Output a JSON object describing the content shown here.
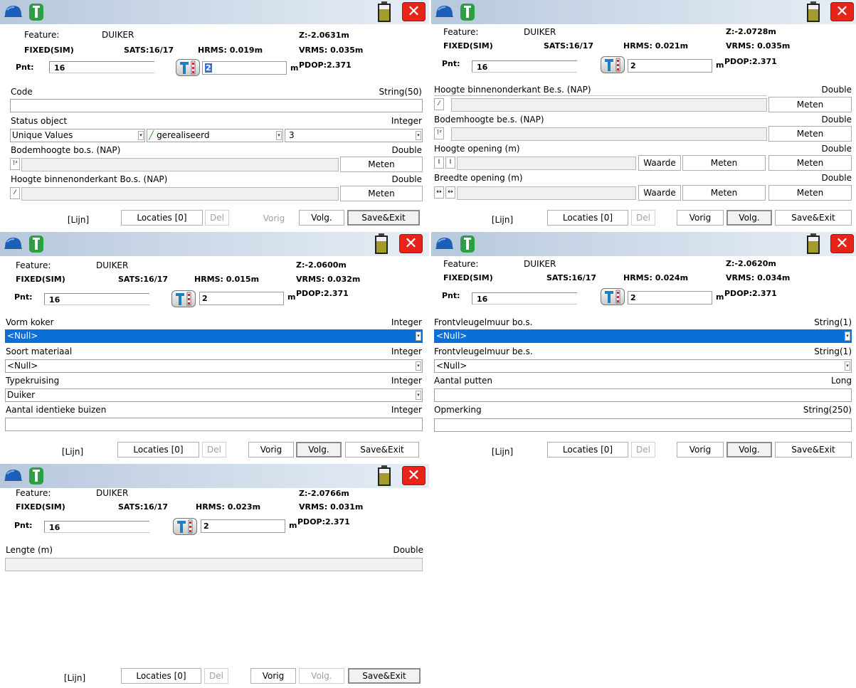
{
  "screens": [
    {
      "feature_label": "Feature:",
      "feature_value": "DUIKER",
      "fix": "FIXED(SIM)",
      "sats": "SATS:16/17",
      "hrms": "HRMS: 0.019m",
      "z": "Z:-2.0631m",
      "vrms": "VRMS: 0.035m",
      "pnt_label": "Pnt:",
      "pnt_value": "16",
      "height_value": "2",
      "unit": "m",
      "pdop": "PDOP:2.371",
      "fields": [
        {
          "label": "Code",
          "type": "String(50)"
        },
        {
          "label": "Status object",
          "type": "Integer",
          "dd1": "Unique Values",
          "dd2": "gerealiseerd",
          "dd3": "3"
        },
        {
          "label": "Bodemhoogte bo.s. (NAP)",
          "type": "Double",
          "button": "Meten"
        },
        {
          "label": "Hoogte binnenonderkant Bo.s.  (NAP)",
          "type": "Double",
          "button": "Meten"
        }
      ],
      "nav": {
        "lijn": "[Lijn]",
        "locaties": "Locaties [0]",
        "del": "Del",
        "vorig": "Vorig",
        "volg": "Volg.",
        "save": "Save&Exit"
      }
    },
    {
      "feature_label": "Feature:",
      "feature_value": "DUIKER",
      "fix": "FIXED(SIM)",
      "sats": "SATS:16/17",
      "hrms": "HRMS: 0.021m",
      "z": "Z:-2.0728m",
      "vrms": "VRMS: 0.035m",
      "pnt_label": "Pnt:",
      "pnt_value": "16",
      "height_value": "2",
      "unit": "m",
      "pdop": "PDOP:2.371",
      "fields": [
        {
          "label": "Hoogte binnenonderkant Be.s.  (NAP)",
          "type": "Double",
          "button": "Meten"
        },
        {
          "label": "Bodemhoogte be.s. (NAP)",
          "type": "Double",
          "button": "Meten"
        },
        {
          "label": "Hoogte opening (m)",
          "type": "Double",
          "waarde": "Waarde",
          "button1": "Meten",
          "button": "Meten"
        },
        {
          "label": "Breedte opening (m)",
          "type": "Double",
          "waarde": "Waarde",
          "button1": "Meten",
          "button": "Meten"
        }
      ],
      "nav": {
        "lijn": "[Lijn]",
        "locaties": "Locaties [0]",
        "del": "Del",
        "vorig": "Vorig",
        "volg": "Volg.",
        "save": "Save&Exit"
      }
    },
    {
      "feature_label": "Feature:",
      "feature_value": "DUIKER",
      "fix": "FIXED(SIM)",
      "sats": "SATS:16/17",
      "hrms": "HRMS: 0.015m",
      "z": "Z:-2.0600m",
      "vrms": "VRMS: 0.032m",
      "pnt_label": "Pnt:",
      "pnt_value": "16",
      "height_value": "2",
      "unit": "m",
      "pdop": "PDOP:2.371",
      "fields": [
        {
          "label": "Vorm koker",
          "type": "Integer",
          "value": "<Null>"
        },
        {
          "label": "Soort materiaal",
          "type": "Integer",
          "value": "<Null>"
        },
        {
          "label": "Typekruising",
          "type": "Integer",
          "value": "Duiker"
        },
        {
          "label": "Aantal identieke buizen",
          "type": "Integer"
        }
      ],
      "nav": {
        "lijn": "[Lijn]",
        "locaties": "Locaties [0]",
        "del": "Del",
        "vorig": "Vorig",
        "volg": "Volg.",
        "save": "Save&Exit"
      }
    },
    {
      "feature_label": "Feature:",
      "feature_value": "DUIKER",
      "fix": "FIXED(SIM)",
      "sats": "SATS:16/17",
      "hrms": "HRMS: 0.024m",
      "z": "Z:-2.0620m",
      "vrms": "VRMS: 0.034m",
      "pnt_label": "Pnt:",
      "pnt_value": "16",
      "height_value": "2",
      "unit": "m",
      "pdop": "PDOP:2.371",
      "fields": [
        {
          "label": "Frontvleugelmuur bo.s.",
          "type": "String(1)",
          "value": "<Null>"
        },
        {
          "label": "Frontvleugelmuur be.s.",
          "type": "String(1)",
          "value": "<Null>"
        },
        {
          "label": "Aantal putten",
          "type": "Long"
        },
        {
          "label": "Opmerking",
          "type": "String(250)"
        }
      ],
      "nav": {
        "lijn": "[Lijn]",
        "locaties": "Locaties [0]",
        "del": "Del",
        "vorig": "Vorig",
        "volg": "Volg.",
        "save": "Save&Exit"
      }
    },
    {
      "feature_label": "Feature:",
      "feature_value": "DUIKER",
      "fix": "FIXED(SIM)",
      "sats": "SATS:16/17",
      "hrms": "HRMS: 0.023m",
      "z": "Z:-2.0766m",
      "vrms": "VRMS: 0.031m",
      "pnt_label": "Pnt:",
      "pnt_value": "16",
      "height_value": "2",
      "unit": "m",
      "pdop": "PDOP:2.371",
      "fields": [
        {
          "label": "Lengte (m)",
          "type": "Double"
        }
      ],
      "nav": {
        "lijn": "[Lijn]",
        "locaties": "Locaties [0]",
        "del": "Del",
        "vorig": "Vorig",
        "volg": "Volg.",
        "save": "Save&Exit"
      }
    }
  ]
}
